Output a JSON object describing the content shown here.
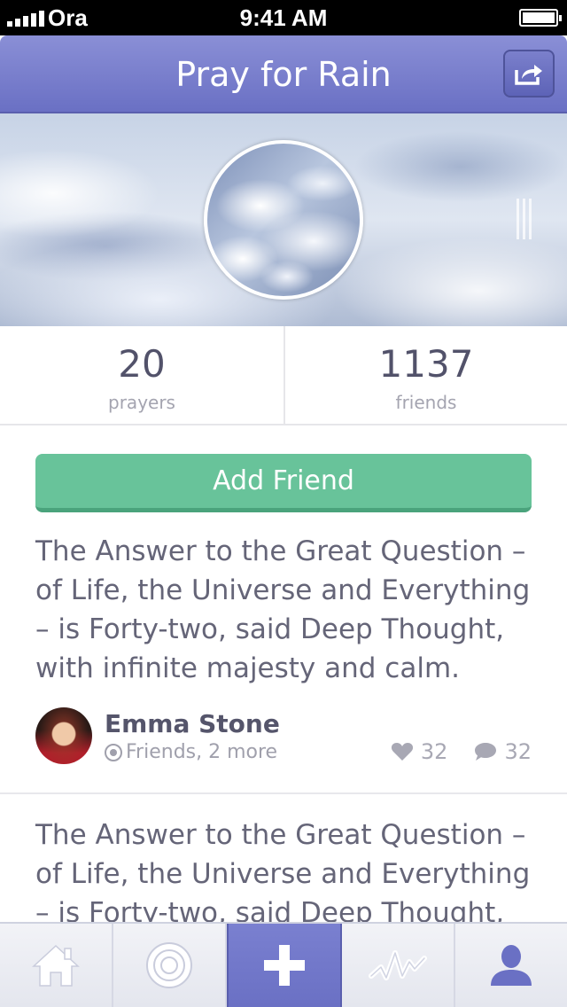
{
  "status": {
    "carrier": "Ora",
    "time": "9:41 AM"
  },
  "header": {
    "title": "Pray for Rain",
    "share_icon": "share-icon"
  },
  "stats": [
    {
      "value": "20",
      "label": "prayers"
    },
    {
      "value": "1137",
      "label": "friends"
    }
  ],
  "add_friend_label": "Add Friend",
  "posts": [
    {
      "text": "The Answer to the Great Question – of Life, the Universe and Everything – is Forty-two, said Deep Thought, with infinite majesty and calm.",
      "author": "Emma Stone",
      "meta": "Friends, 2 more",
      "likes": "32",
      "comments": "32"
    },
    {
      "text": "The Answer to the Great Question – of Life, the Universe and Everything – is Forty-two, said Deep Thought, with"
    }
  ],
  "tabs": [
    {
      "icon": "home-icon"
    },
    {
      "icon": "target-icon"
    },
    {
      "icon": "plus-icon",
      "active": true
    },
    {
      "icon": "activity-icon"
    },
    {
      "icon": "profile-icon"
    }
  ],
  "colors": {
    "accent": "#6a70c4",
    "button_green": "#68c39a",
    "text": "#656578"
  }
}
